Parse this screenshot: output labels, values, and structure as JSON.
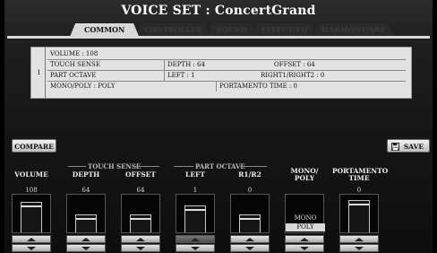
{
  "window": {
    "title": "VOICE SET : ConcertGrand"
  },
  "tabs": [
    {
      "label": "COMMON"
    },
    {
      "label": "CONTROLLER"
    },
    {
      "label": "SOUND"
    },
    {
      "label": "EFFECT/EQ"
    },
    {
      "label": "HARMONY/ARP"
    }
  ],
  "info": {
    "number": "1",
    "volume": "VOLUME : 108",
    "touch_sense": "TOUCH SENSE",
    "depth": "DEPTH : 64",
    "offset": "OFFSET : 64",
    "part_octave": "PART OCTAVE",
    "left": "LEFT : 1",
    "right": "RIGHT1/RIGHT2 : 0",
    "mono_poly": "MONO/POLY : POLY",
    "portamento": "PORTAMENTO TIME : 0"
  },
  "buttons": {
    "compare": "COMPARE",
    "save": "SAVE"
  },
  "groups": {
    "touch_sense": "TOUCH SENSE",
    "part_octave": "PART OCTAVE"
  },
  "params": {
    "volume": {
      "label": "VOLUME",
      "value": "108",
      "level": 0.85
    },
    "depth": {
      "label": "DEPTH",
      "value": "64",
      "level": 0.5
    },
    "offset": {
      "label": "OFFSET",
      "value": "64",
      "level": 0.5
    },
    "left": {
      "label": "LEFT",
      "value": "1",
      "level": 0.75
    },
    "r1r2": {
      "label": "R1/R2",
      "value": "0",
      "level": 0.5
    },
    "monopoly": {
      "label": "MONO/\nPOLY",
      "options": [
        "MONO",
        "POLY"
      ],
      "selected": "POLY"
    },
    "portamento": {
      "label": "PORTAMENTO\nTIME",
      "value": "0",
      "level": 0.9
    }
  }
}
